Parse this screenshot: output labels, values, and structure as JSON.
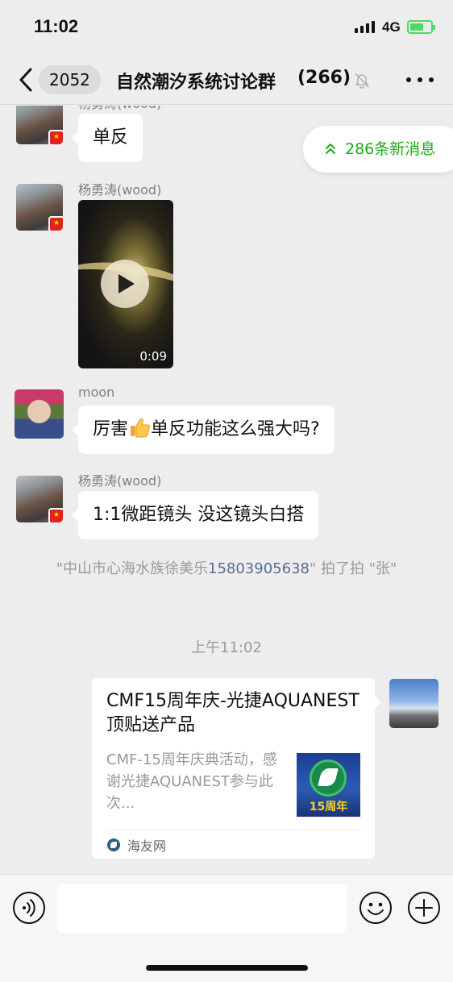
{
  "status_bar": {
    "time": "11:02",
    "network": "4G",
    "battery_level": 0.65,
    "battery_color": "#4cd964"
  },
  "nav": {
    "unread_count": "2052",
    "title": "自然潮汐系统讨论群",
    "member_count": "(266)",
    "muted": true
  },
  "new_messages_pill": {
    "label": "286条新消息",
    "color": "#1aad19"
  },
  "messages": [
    {
      "sender": "杨勇涛(wood)",
      "type": "text",
      "text": "单反"
    },
    {
      "sender": "杨勇涛(wood)",
      "type": "video",
      "duration": "0:09"
    },
    {
      "sender": "moon",
      "type": "text",
      "text_before": "厉害",
      "emoji": "thumbs-up",
      "text_after": "单反功能这么强大吗?"
    },
    {
      "sender": "杨勇涛(wood)",
      "type": "text",
      "text": "1:1微距镜头 没这镜头白搭"
    }
  ],
  "system_notice": {
    "prefix": "\"中山市心海水族徐美乐",
    "phone": "15803905638",
    "suffix": "\" 拍了拍 \"张\""
  },
  "time_label": "上午11:02",
  "link_card": {
    "title": "CMF15周年庆-光捷AQUANEST顶贴送产品",
    "description": "CMF-15周年庆典活动，感谢光捷AQUANEST参与此次...",
    "thumb_text": "15周年",
    "source": "海友网"
  },
  "input_bar": {
    "placeholder": ""
  }
}
